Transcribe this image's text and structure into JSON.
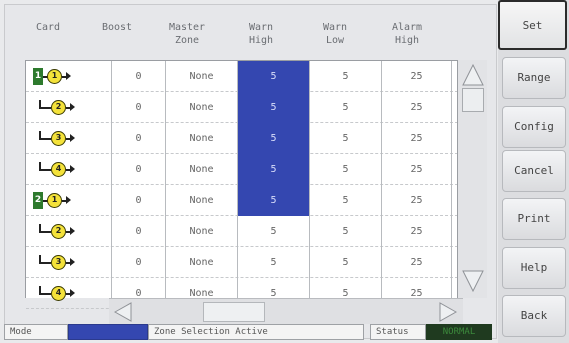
{
  "columns": [
    "Card",
    "Boost",
    "Master\nZone",
    "Warn\nHigh",
    "Warn\nLow",
    "Alarm\nHigh"
  ],
  "rows": [
    {
      "card_num": "1",
      "zone": "1",
      "root": true,
      "boost": "0",
      "master_zone": "None",
      "warn_high": "5",
      "warn_low": "5",
      "alarm_high": "25",
      "highlight": true
    },
    {
      "card_num": "",
      "zone": "2",
      "root": false,
      "boost": "0",
      "master_zone": "None",
      "warn_high": "5",
      "warn_low": "5",
      "alarm_high": "25",
      "highlight": true
    },
    {
      "card_num": "",
      "zone": "3",
      "root": false,
      "boost": "0",
      "master_zone": "None",
      "warn_high": "5",
      "warn_low": "5",
      "alarm_high": "25",
      "highlight": true
    },
    {
      "card_num": "",
      "zone": "4",
      "root": false,
      "boost": "0",
      "master_zone": "None",
      "warn_high": "5",
      "warn_low": "5",
      "alarm_high": "25",
      "highlight": true
    },
    {
      "card_num": "2",
      "zone": "1",
      "root": true,
      "boost": "0",
      "master_zone": "None",
      "warn_high": "5",
      "warn_low": "5",
      "alarm_high": "25",
      "highlight": true
    },
    {
      "card_num": "",
      "zone": "2",
      "root": false,
      "boost": "0",
      "master_zone": "None",
      "warn_high": "5",
      "warn_low": "5",
      "alarm_high": "25",
      "highlight": false
    },
    {
      "card_num": "",
      "zone": "3",
      "root": false,
      "boost": "0",
      "master_zone": "None",
      "warn_high": "5",
      "warn_low": "5",
      "alarm_high": "25",
      "highlight": false
    },
    {
      "card_num": "",
      "zone": "4",
      "root": false,
      "boost": "0",
      "master_zone": "None",
      "warn_high": "5",
      "warn_low": "5",
      "alarm_high": "25",
      "highlight": false
    }
  ],
  "status_bar": {
    "mode_label": "Mode",
    "message": "Zone Selection Active",
    "status_label": "Status",
    "status_value": "NORMAL"
  },
  "side_buttons": [
    {
      "label": "Set",
      "active": true
    },
    {
      "label": "Range",
      "active": false
    },
    {
      "label": "Config",
      "active": false
    },
    {
      "label": "Cancel",
      "active": false
    },
    {
      "label": "Print",
      "active": false
    },
    {
      "label": "Help",
      "active": false
    },
    {
      "label": "Back",
      "active": false
    }
  ],
  "colors": {
    "highlight": "#3447b0",
    "normal_text": "#3c8a3c",
    "card_badge": "#2d7a2d",
    "zone_coin": "#f4e23a"
  },
  "icons": {
    "scroll_up": "triangle-up-icon",
    "scroll_down": "triangle-down-icon",
    "scroll_left": "triangle-left-icon",
    "scroll_right": "triangle-right-icon"
  }
}
